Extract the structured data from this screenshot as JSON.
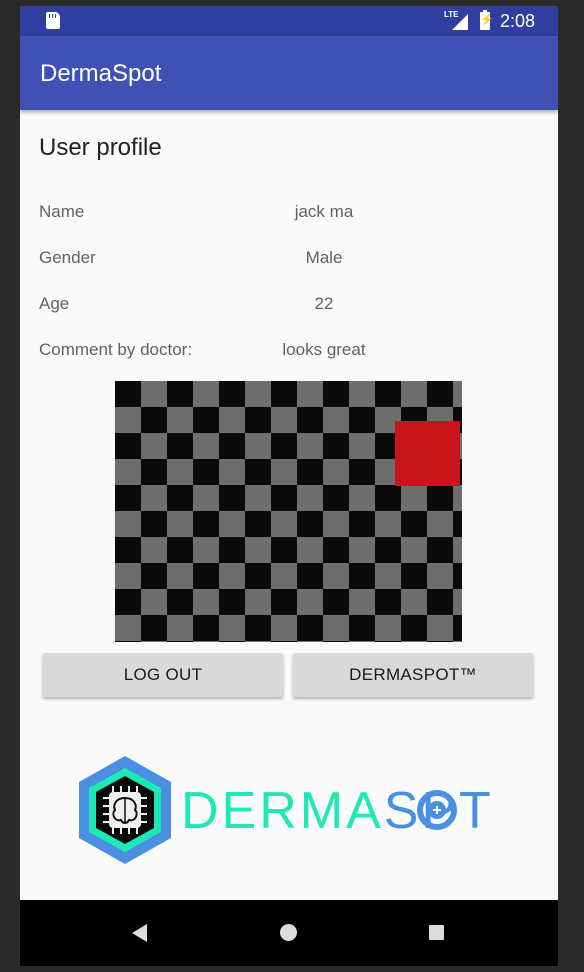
{
  "status_bar": {
    "time": "2:08",
    "network": "LTE"
  },
  "app_bar": {
    "title": "DermaSpot"
  },
  "profile": {
    "title": "User profile",
    "fields": [
      {
        "label": "Name",
        "value": "jack ma"
      },
      {
        "label": "Gender",
        "value": "Male"
      },
      {
        "label": "Age",
        "value": "22"
      },
      {
        "label": "Comment by doctor:",
        "value": "looks great"
      }
    ]
  },
  "buttons": {
    "logout": "LOG OUT",
    "dermaspot": "DERMASPOT™"
  },
  "logo": {
    "word_left": "DERMA",
    "word_right": "SP",
    "word_end": "T"
  },
  "colors": {
    "status_bar": "#303f9f",
    "app_bar": "#3f51b5",
    "logo_teal": "#1de9b6",
    "logo_blue": "#4a90e2",
    "spot_red": "#c8141a"
  }
}
